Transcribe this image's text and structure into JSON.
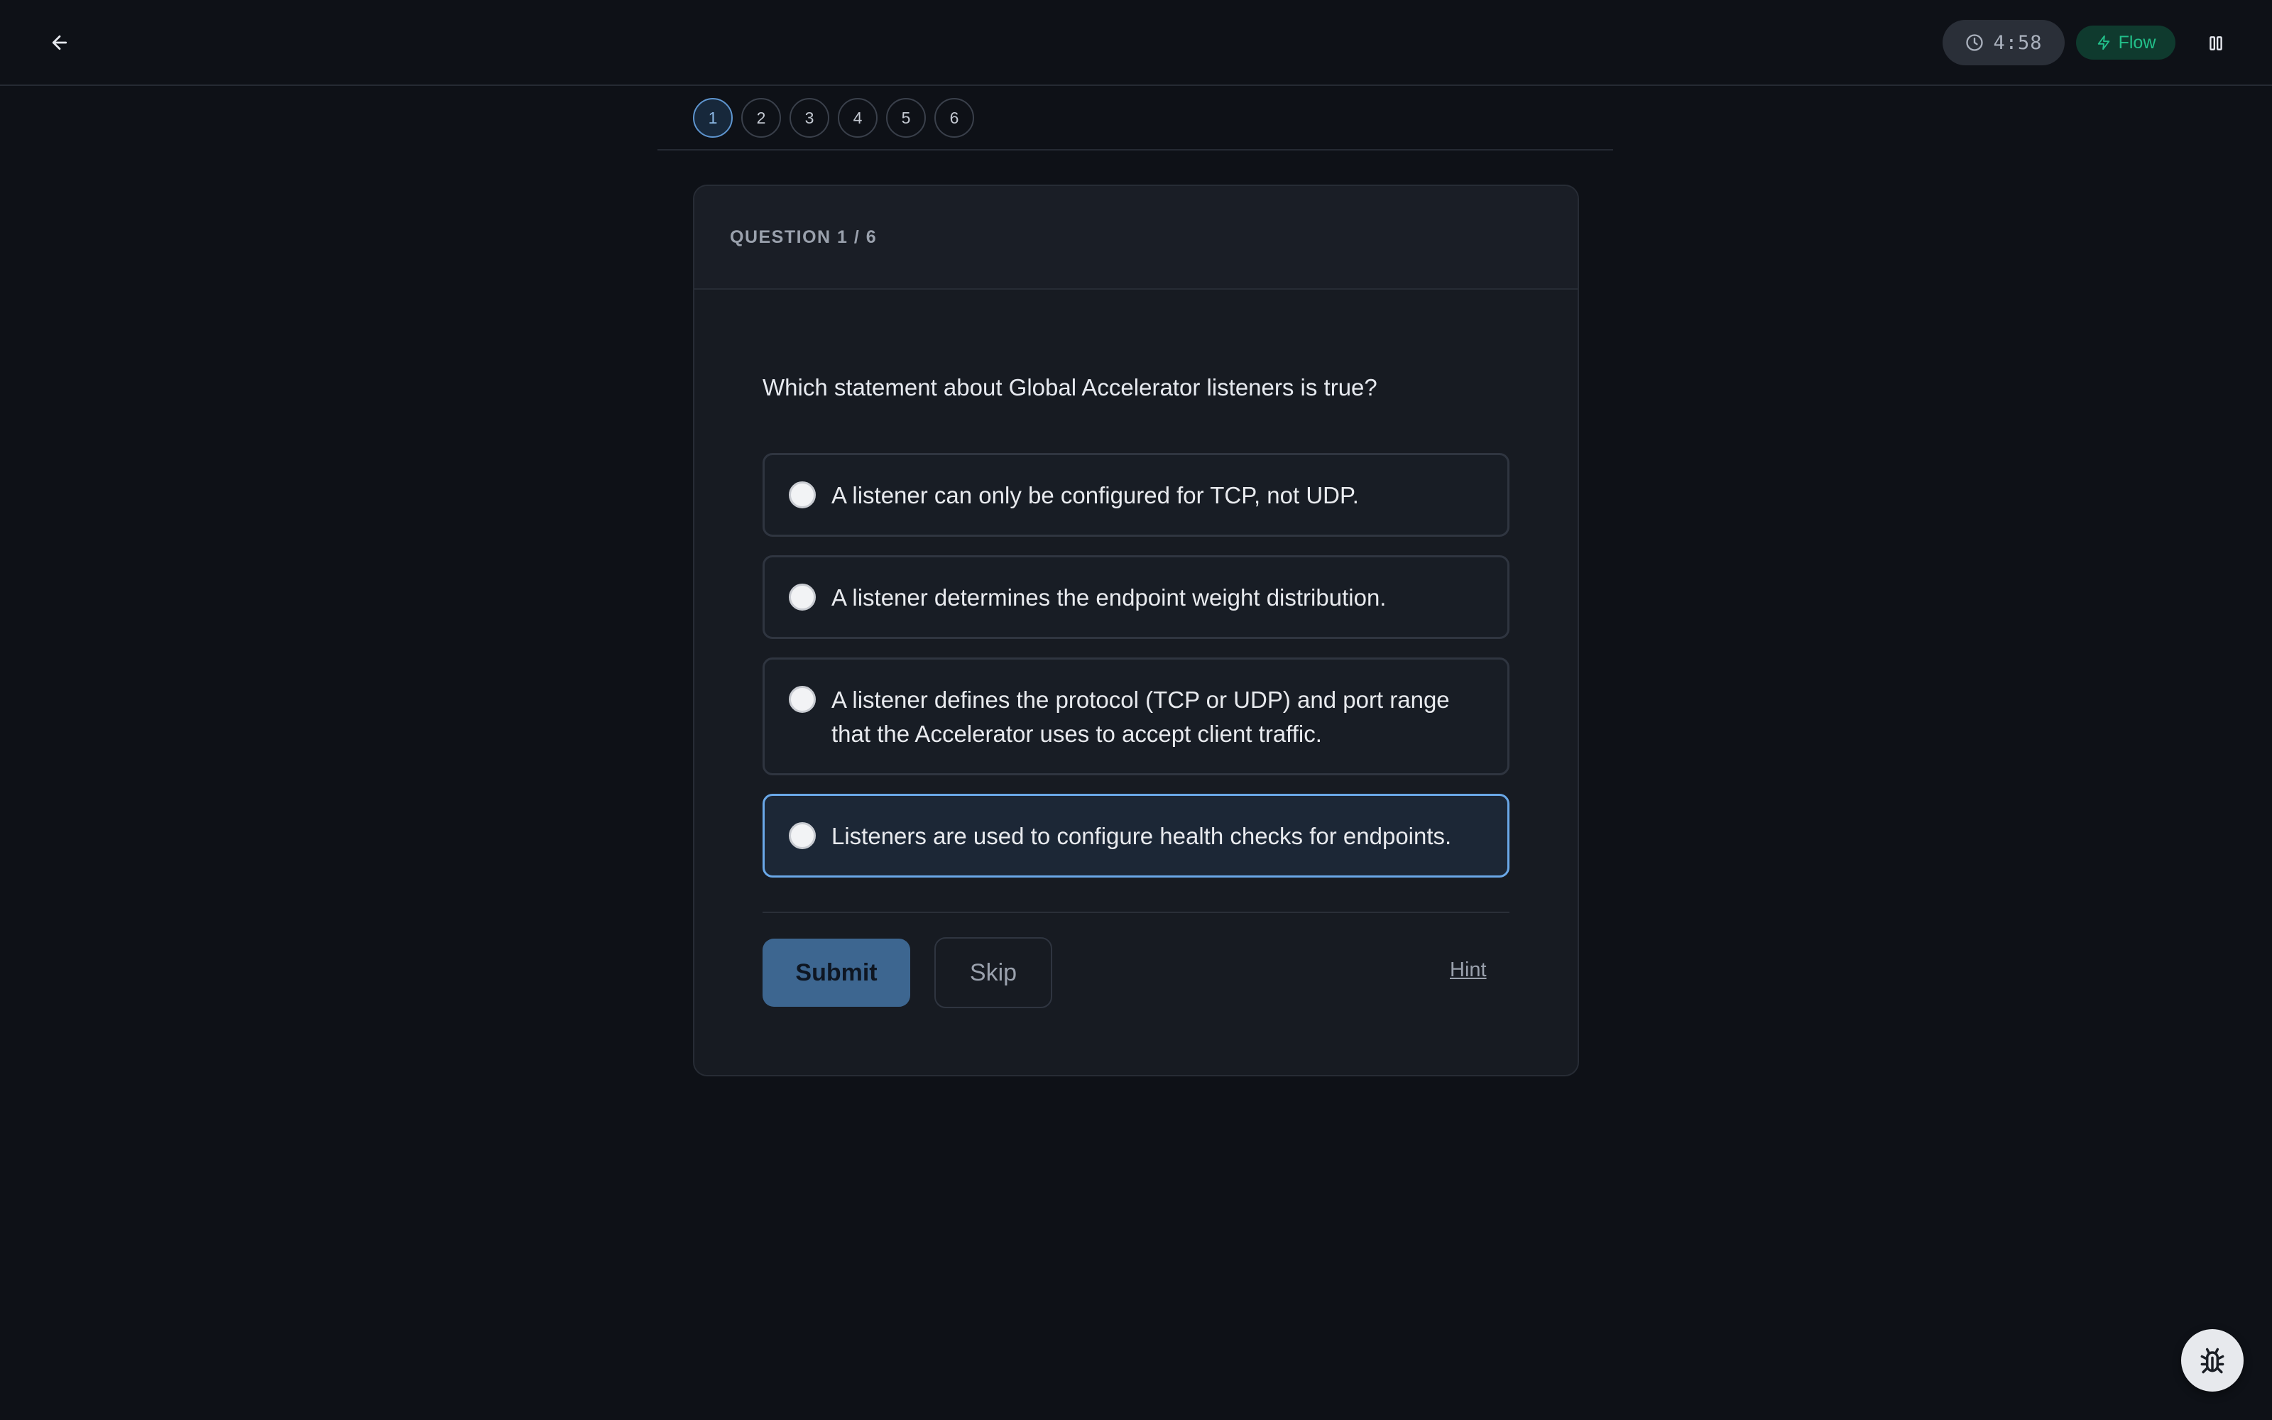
{
  "header": {
    "timer": "4:58",
    "mode_label": "Flow"
  },
  "question_nav": {
    "items": [
      "1",
      "2",
      "3",
      "4",
      "5",
      "6"
    ],
    "active_index": 0
  },
  "card": {
    "progress_label": "QUESTION 1 / 6",
    "question": "Which statement about Global Accelerator listeners is true?",
    "options": [
      {
        "text": "A listener can only be configured for TCP, not UDP.",
        "selected": false
      },
      {
        "text": "A listener determines the endpoint weight distribution.",
        "selected": false
      },
      {
        "text": "A listener defines the protocol (TCP or UDP) and port range that the Accelerator uses to accept client traffic.",
        "selected": false
      },
      {
        "text": "Listeners are used to configure health checks for endpoints.",
        "selected": false,
        "highlighted": true
      }
    ],
    "submit_label": "Submit",
    "skip_label": "Skip",
    "hint_label": "Hint"
  },
  "colors": {
    "background": "#0e1117",
    "accent": "#6aa8e8",
    "flow_green": "#22c08a"
  },
  "icons": {
    "back": "arrow-left-icon",
    "timer": "clock-icon",
    "flow": "lightning-icon",
    "pause": "pause-icon",
    "bug": "bug-icon"
  }
}
